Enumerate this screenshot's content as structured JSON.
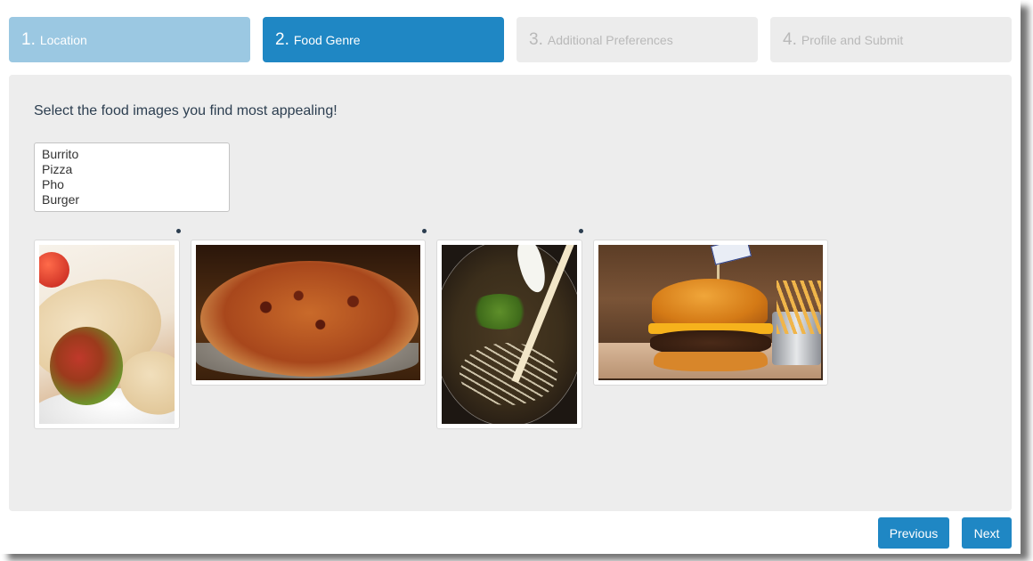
{
  "steps": [
    {
      "num": "1.",
      "label": "Location",
      "state": "done"
    },
    {
      "num": "2.",
      "label": "Food Genre",
      "state": "active"
    },
    {
      "num": "3.",
      "label": "Additional Preferences",
      "state": "todo"
    },
    {
      "num": "4.",
      "label": "Profile and Submit",
      "state": "todo"
    }
  ],
  "main": {
    "prompt": "Select the food images you find most appealing!",
    "options": [
      "Burrito",
      "Pizza",
      "Pho",
      "Burger"
    ]
  },
  "images": [
    {
      "icon": "burrito-image"
    },
    {
      "icon": "pizza-image"
    },
    {
      "icon": "pho-image"
    },
    {
      "icon": "burger-image"
    }
  ],
  "nav": {
    "previous_label": "Previous",
    "next_label": "Next"
  },
  "colors": {
    "accent": "#1f87c4",
    "step_done": "#9bc8e2",
    "step_todo": "#ececec",
    "panel": "#ededed"
  }
}
